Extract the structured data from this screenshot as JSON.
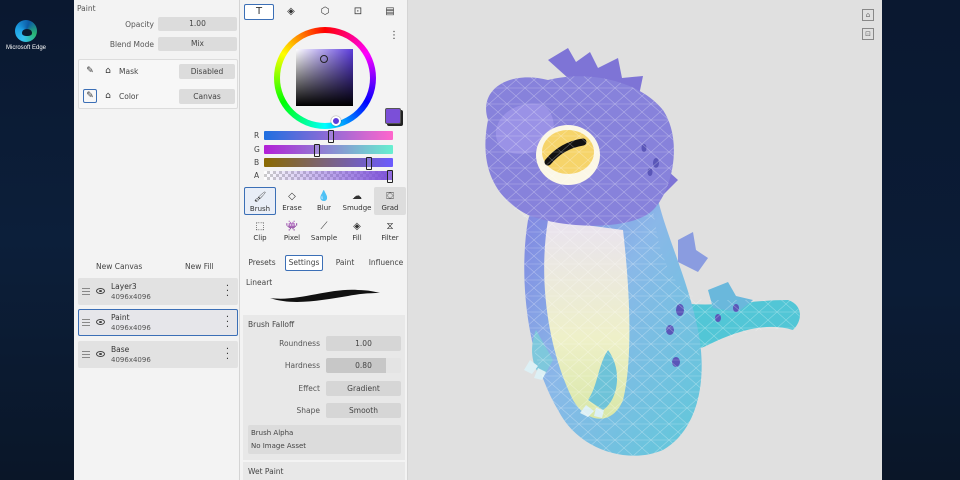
{
  "desktop": {
    "icon_label": "Microsoft Edge"
  },
  "layer_panel": {
    "section_title": "Paint",
    "opacity_label": "Opacity",
    "opacity_value": "1.00",
    "blend_label": "Blend Mode",
    "blend_value": "Mix",
    "mask_label": "Mask",
    "mask_value": "Disabled",
    "color_label": "Color",
    "color_value": "Canvas",
    "new_canvas": "New Canvas",
    "new_fill": "New Fill",
    "layers": [
      {
        "name": "Layer3",
        "size": "4096x4096"
      },
      {
        "name": "Paint",
        "size": "4096x4096"
      },
      {
        "name": "Base",
        "size": "4096x4096"
      }
    ]
  },
  "color": {
    "current": "#7b4fd8",
    "channel_r": "R",
    "channel_g": "G",
    "channel_b": "B",
    "channel_a": "A",
    "r": 0.52,
    "g": 0.41,
    "b": 0.83,
    "a": 1.0
  },
  "tools": {
    "row1": [
      "Brush",
      "Erase",
      "Blur",
      "Smudge",
      "Grad"
    ],
    "row2": [
      "Clip",
      "Pixel",
      "Sample",
      "Fill",
      "Filter"
    ]
  },
  "brush_tabs": [
    "Presets",
    "Settings",
    "Paint",
    "Influence"
  ],
  "brush": {
    "lineart_label": "Lineart",
    "falloff_title": "Brush Falloff",
    "roundness_label": "Roundness",
    "roundness_value": "1.00",
    "hardness_label": "Hardness",
    "hardness_value": "0.80",
    "effect_label": "Effect",
    "effect_value": "Gradient",
    "shape_label": "Shape",
    "shape_value": "Smooth",
    "alpha_title": "Brush Alpha",
    "alpha_value": "No Image Asset",
    "wet_paint": "Wet Paint"
  }
}
